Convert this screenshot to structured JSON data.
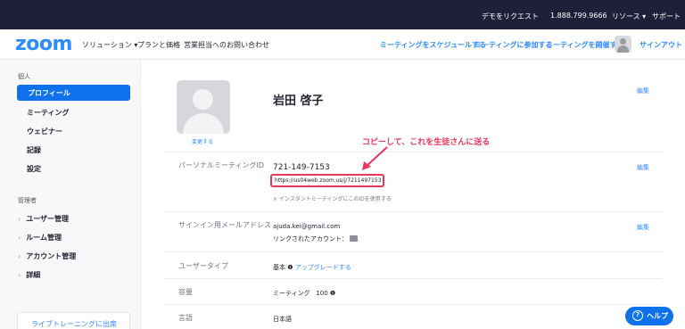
{
  "topbar": {
    "request_demo": "デモをリクエスト",
    "phone": "1.888.799.9666",
    "resources": "リソース ▾",
    "support": "サポート"
  },
  "nav": {
    "logo": "zoom",
    "solutions": "ソリューション ▾",
    "plans": "プランと価格",
    "contact_sales": "営業担当へのお問い合わせ",
    "schedule": "ミーティングをスケジュールする",
    "join": "ミーティングに参加する",
    "host": "ミーティングを開催する ▾",
    "sign_in": "サインアウト"
  },
  "sidebar": {
    "personal_header": "個人",
    "personal_items": [
      "プロフィール",
      "ミーティング",
      "ウェビナー",
      "記録",
      "設定"
    ],
    "admin_header": "管理者",
    "admin_items": [
      "ユーザー管理",
      "ルーム管理",
      "アカウント管理",
      "詳細"
    ],
    "training": "ライブトレーニングに出席",
    "active_index": 0
  },
  "profile": {
    "change": "変更する",
    "name": "岩田 啓子",
    "edit": "編集",
    "pmi_label": "パーソナルミーティングID",
    "pmi_value": "721-149-7153",
    "pmi_url": "https://us04web.zoom.us/j/7211497153",
    "pmi_note": "× インスタントミーティングにこのIDを使用する",
    "email_label": "サインイン用メールアドレス",
    "email_value": "ajuda.kei@gmail.com",
    "linked": "リンクされたアカウント：",
    "type_label": "ユーザータイプ",
    "type_value": "基本",
    "upgrade": "アップグレードする",
    "capacity_label": "容量",
    "capacity_meeting": "ミーティング",
    "capacity_value": "100",
    "lang_label": "言語",
    "lang_value": "日本語"
  },
  "callout": "コピーして、これを生徒さんに送る",
  "help": "ヘルプ",
  "colors": {
    "brand": "#2d8cff",
    "active": "#0e72ed",
    "annotation": "#e8365d",
    "topbar": "#1f1f3a"
  }
}
